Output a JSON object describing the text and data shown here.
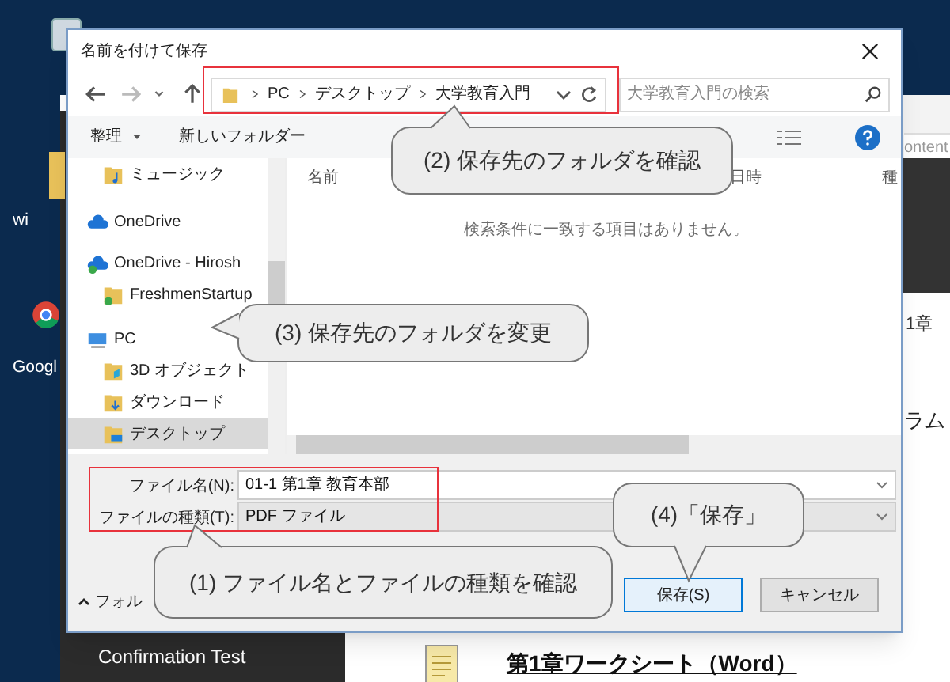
{
  "desktop": {
    "icons": [
      {
        "label": "wi",
        "kind": "folder"
      },
      {
        "label": "Googl",
        "kind": "browser"
      }
    ]
  },
  "background_window": {
    "header_text": "ontent",
    "texts": [
      "1章",
      "ラム"
    ],
    "sidebar_item": "Confirmation Test",
    "link": "第1章ワークシート（Word）"
  },
  "dialog": {
    "title": "名前を付けて保存",
    "breadcrumb": [
      "PC",
      "デスクトップ",
      "大学教育入門"
    ],
    "search": {
      "placeholder": "大学教育入門の検索"
    },
    "toolbar": [
      "整理",
      "新しいフォルダー"
    ],
    "nav_items": [
      {
        "label": "ミュージック",
        "kind": "music",
        "selected": false
      },
      {
        "label": "OneDrive",
        "kind": "cloud",
        "selected": false
      },
      {
        "label": "OneDrive - Hirosh",
        "kind": "cloud-synced",
        "selected": false,
        "children": [
          {
            "label": "FreshmenStartup",
            "kind": "folder-synced",
            "selected": false
          }
        ]
      },
      {
        "label": "PC",
        "kind": "pc",
        "selected": false,
        "children": [
          {
            "label": "3D オブジェクト",
            "kind": "folder-3d",
            "selected": false
          },
          {
            "label": "ダウンロード",
            "kind": "folder-download",
            "selected": false
          },
          {
            "label": "デスクトップ",
            "kind": "folder-desktop",
            "selected": true
          }
        ]
      }
    ],
    "columns": [
      "名前",
      "日時",
      "種"
    ],
    "empty_message": "検索条件に一致する項目はありません。",
    "file_name": {
      "label": "ファイル名(N):",
      "value": "01-1 第1章 教育本部"
    },
    "file_type": {
      "label": "ファイルの種類(T):",
      "value": "PDF ファイル"
    },
    "hide_folders": "フォル",
    "buttons": [
      {
        "label": "保存(S)",
        "kind": "primary"
      },
      {
        "label": "キャンセル",
        "kind": "normal"
      }
    ]
  },
  "callouts": [
    {
      "text": "(2) 保存先のフォルダを確認"
    },
    {
      "text": "(3) 保存先のフォルダを変更"
    },
    {
      "text": "(1) ファイル名とファイルの種類を確認"
    },
    {
      "text": "(4)「保存」"
    }
  ]
}
